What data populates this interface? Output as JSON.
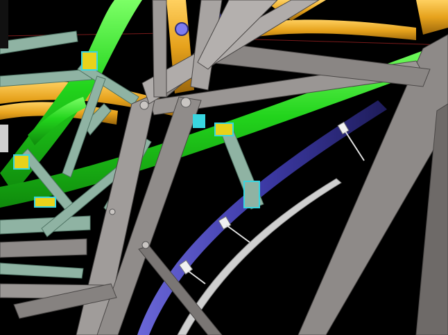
{
  "scene": {
    "colors": {
      "background": "#000000",
      "steel_gray": "#8e8a88",
      "steel_gray_dark": "#5f5b5a",
      "steel_gray_light": "#b9b5b2",
      "brace_green_gray": "#8fb3a3",
      "brace_green_gray_dark": "#5d8474",
      "pipe_green": "#22d41c",
      "pipe_green_dark": "#12910e",
      "pipe_orange": "#e6a21c",
      "pipe_orange_dark": "#a16b0c",
      "pipe_blue": "#3d3aa6",
      "pipe_blue_dark": "#23206a",
      "pipe_light_gray": "#cfcfcf",
      "connection_yellow": "#e8d21a",
      "connection_cyan": "#38d6e0",
      "clamp_white": "#f1f1f1"
    },
    "element_types": [
      "steel-beam",
      "diagonal-brace",
      "green-pipe",
      "orange-pipe",
      "blue-pipe",
      "light-gray-pipe",
      "pipe-clamp",
      "bolted-connection"
    ]
  }
}
